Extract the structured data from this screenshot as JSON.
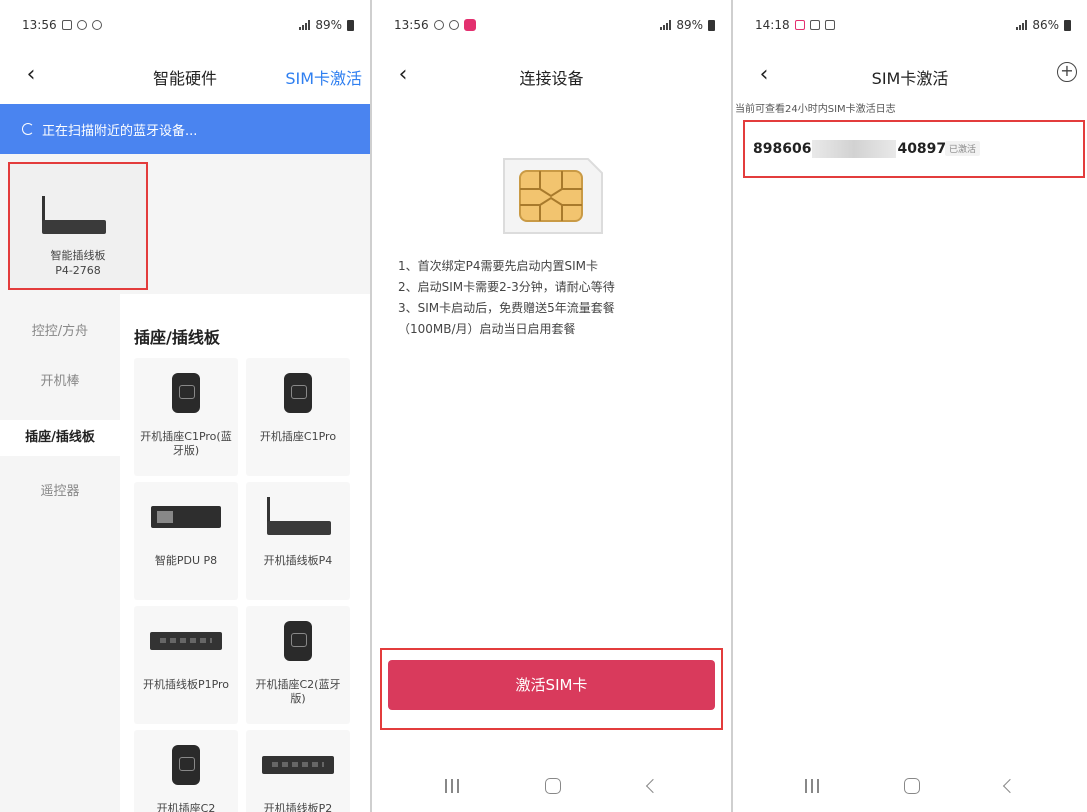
{
  "panels": {
    "hardware": {
      "status": {
        "time": "13:56",
        "battery": "89%"
      },
      "nav": {
        "title": "智能硬件",
        "right_action": "SIM卡激活"
      },
      "scan_text": "正在扫描附近的蓝牙设备...",
      "found_device": {
        "name_line1": "智能插线板",
        "name_line2": "P4-2768"
      },
      "categories": [
        {
          "label": "控控/方舟",
          "active": false
        },
        {
          "label": "开机棒",
          "active": false
        },
        {
          "label": "插座/插线板",
          "active": true
        },
        {
          "label": "遥控器",
          "active": false
        }
      ],
      "section_title": "插座/插线板",
      "products": [
        {
          "label": "开机插座C1Pro(蓝牙版)",
          "icon": "socket"
        },
        {
          "label": "开机插座C1Pro",
          "icon": "socket"
        },
        {
          "label": "智能PDU P8",
          "icon": "pdu"
        },
        {
          "label": "开机插线板P4",
          "icon": "power-strip-antenna"
        },
        {
          "label": "开机插线板P1Pro",
          "icon": "power-strip"
        },
        {
          "label": "开机插座C2(蓝牙版)",
          "icon": "socket"
        },
        {
          "label": "开机插座C2",
          "icon": "socket"
        },
        {
          "label": "开机插线板P2",
          "icon": "power-strip"
        }
      ]
    },
    "connect": {
      "status": {
        "time": "13:56",
        "battery": "89%"
      },
      "nav": {
        "title": "连接设备"
      },
      "instructions": [
        "1、首次绑定P4需要先启动内置SIM卡",
        "2、启动SIM卡需要2-3分钟，请耐心等待",
        "3、SIM卡启动后，免费赠送5年流量套餐",
        "（100MB/月）启动当日启用套餐"
      ],
      "activate_button": "激活SIM卡"
    },
    "sim": {
      "status": {
        "time": "14:18",
        "battery": "86%"
      },
      "nav": {
        "title": "SIM卡激活"
      },
      "log_hint": "当前可查看24小时内SIM卡激活日志",
      "log_entry": {
        "prefix": "898606",
        "suffix": "40897",
        "status": "已激活"
      }
    }
  },
  "colors": {
    "accent_blue": "#4a84f0",
    "link_blue": "#2f7ff0",
    "button_red": "#d93a5c",
    "highlight_red": "#e33c3c"
  }
}
